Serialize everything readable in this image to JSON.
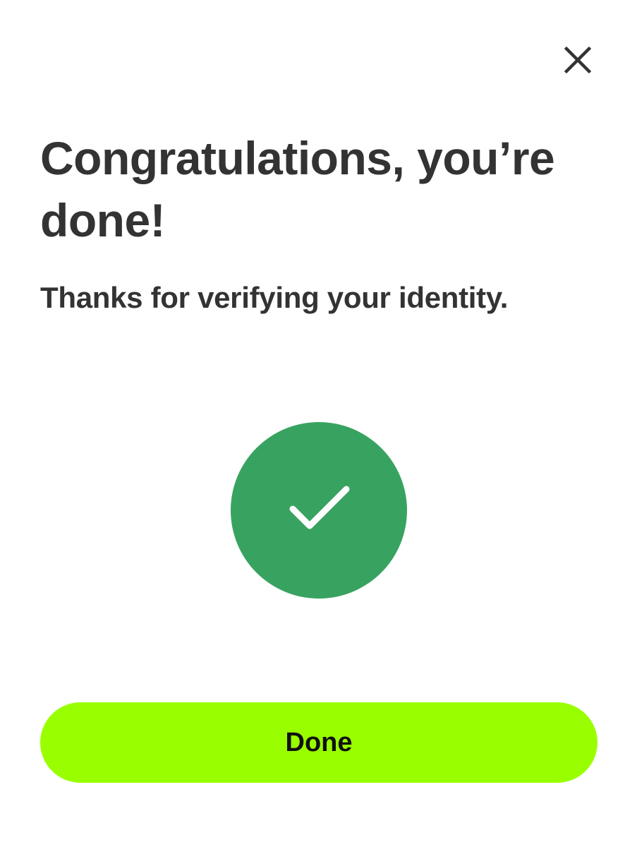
{
  "header": {
    "close_icon": "close-icon"
  },
  "content": {
    "title": "Congratulations, you’re done!",
    "subtitle": "Thanks for verifying your identity.",
    "status_icon": "checkmark-icon"
  },
  "footer": {
    "done_label": "Done"
  },
  "colors": {
    "text": "#333333",
    "success": "#38A360",
    "button_bg": "#99FF00",
    "button_text": "#111111",
    "icon": "#333333"
  }
}
